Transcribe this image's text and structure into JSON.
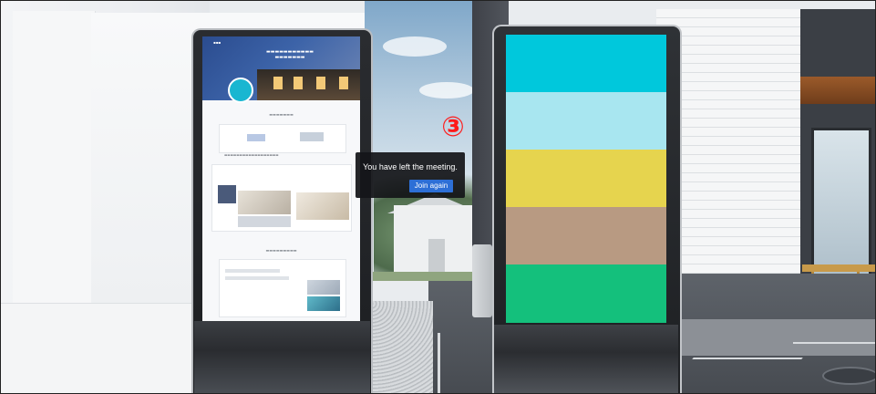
{
  "meeting_notice": {
    "message": "You have left the meeting.",
    "rejoin_label": "Join again",
    "button_color": "#2d6fd6"
  },
  "step_annotation": {
    "label": "③",
    "color": "#ff1a1a"
  },
  "left_display": {
    "content": "website-page"
  },
  "right_display": {
    "stripes": [
      "#00c8dc",
      "#a8e6f0",
      "#e6d44e",
      "#b89a82",
      "#14c07c"
    ]
  }
}
